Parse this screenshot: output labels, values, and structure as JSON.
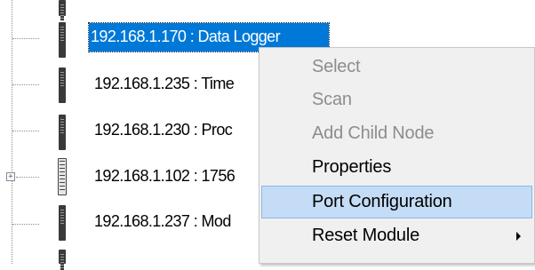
{
  "tree": {
    "nodes": [
      {
        "label": "192.168.1.170 : Data Logger",
        "selected": true,
        "icon": "module-icon"
      },
      {
        "label": "192.168.1.235 : Time",
        "selected": false,
        "icon": "module-icon"
      },
      {
        "label": "192.168.1.230 : Proc",
        "selected": false,
        "icon": "module-icon"
      },
      {
        "label": "192.168.1.102 : 1756",
        "selected": false,
        "icon": "chassis-icon",
        "expander": "+"
      },
      {
        "label": "192.168.1.237 : Mod",
        "selected": false,
        "icon": "module-icon"
      }
    ]
  },
  "context_menu": {
    "items": [
      {
        "label": "Select",
        "enabled": false
      },
      {
        "label": "Scan",
        "enabled": false
      },
      {
        "label": "Add Child Node",
        "enabled": false
      },
      {
        "label": "Properties",
        "enabled": true
      },
      {
        "label": "Port Configuration",
        "enabled": true,
        "highlighted": true
      },
      {
        "label": "Reset Module",
        "enabled": true,
        "submenu": true
      }
    ],
    "submenu_arrow_icon": "chevron-right-icon"
  }
}
